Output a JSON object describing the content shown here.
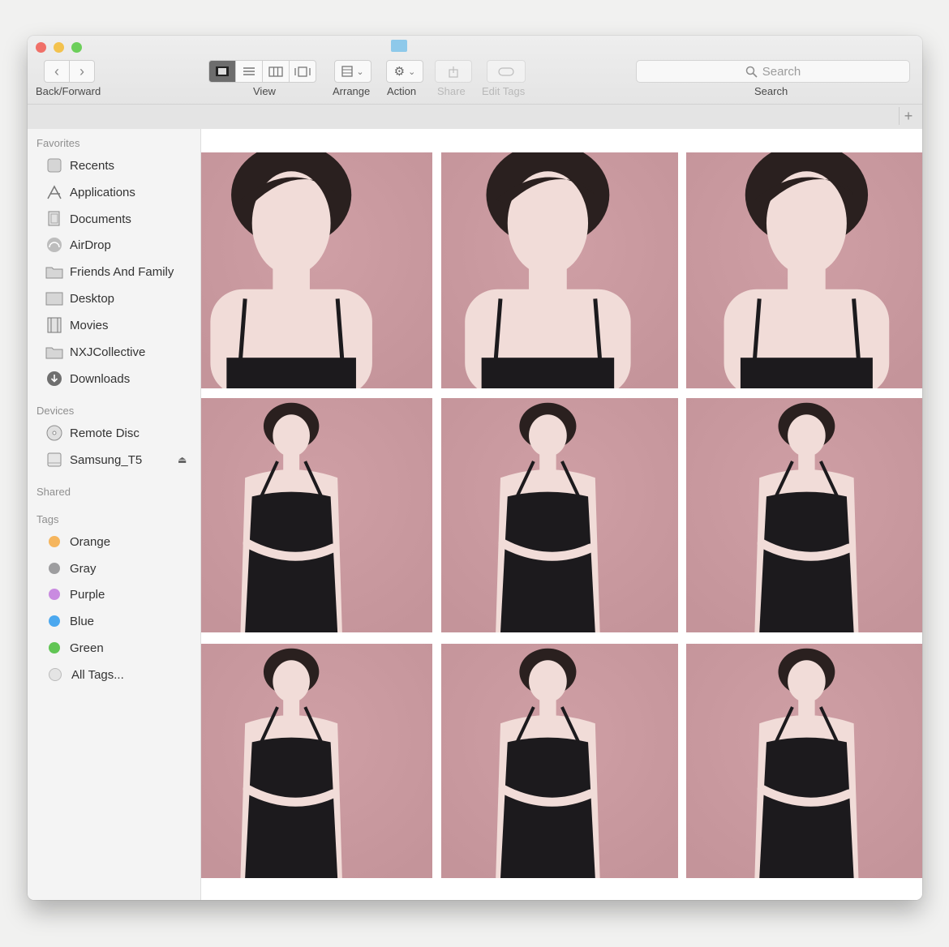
{
  "toolbar": {
    "back_forward_label": "Back/Forward",
    "view_label": "View",
    "arrange_label": "Arrange",
    "action_label": "Action",
    "share_label": "Share",
    "edit_tags_label": "Edit Tags",
    "search_placeholder": "Search",
    "search_label": "Search"
  },
  "sidebar": {
    "favorites_title": "Favorites",
    "favorites": [
      {
        "label": "Recents",
        "icon": "recents-icon"
      },
      {
        "label": "Applications",
        "icon": "applications-icon"
      },
      {
        "label": "Documents",
        "icon": "documents-icon"
      },
      {
        "label": "AirDrop",
        "icon": "airdrop-icon"
      },
      {
        "label": "Friends And Family",
        "icon": "folder-icon"
      },
      {
        "label": "Desktop",
        "icon": "desktop-icon"
      },
      {
        "label": "Movies",
        "icon": "movies-icon"
      },
      {
        "label": "NXJCollective",
        "icon": "folder-icon"
      },
      {
        "label": "Downloads",
        "icon": "downloads-icon"
      }
    ],
    "devices_title": "Devices",
    "devices": [
      {
        "label": "Remote Disc",
        "icon": "remote-disc-icon"
      },
      {
        "label": "Samsung_T5",
        "icon": "drive-icon"
      }
    ],
    "shared_title": "Shared",
    "tags_title": "Tags",
    "tags": [
      {
        "label": "Orange",
        "color": "#f5b55d"
      },
      {
        "label": "Gray",
        "color": "#9d9d9f"
      },
      {
        "label": "Purple",
        "color": "#c98be0"
      },
      {
        "label": "Blue",
        "color": "#4ba8ef"
      },
      {
        "label": "Green",
        "color": "#61c554"
      },
      {
        "label": "All Tags...",
        "color": "#e4e4e4"
      }
    ]
  },
  "photos": [
    "photo-1",
    "photo-2",
    "photo-3",
    "photo-4",
    "photo-5",
    "photo-6",
    "photo-7",
    "photo-8",
    "photo-9"
  ],
  "colors": {
    "photo_background": "#c4949a",
    "dress": "#1c1a1d",
    "skin": "#f1dcd8",
    "hair": "#2a201f"
  }
}
